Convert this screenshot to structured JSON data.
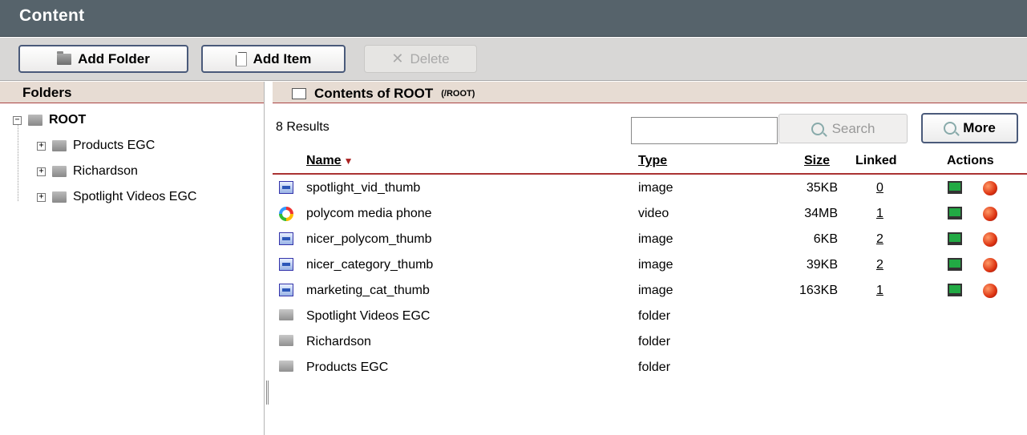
{
  "app": {
    "title": "Content"
  },
  "toolbar": {
    "add_folder_label": "Add Folder",
    "add_item_label": "Add Item",
    "delete_label": "Delete"
  },
  "folders_panel": {
    "title": "Folders",
    "root_label": "ROOT",
    "children": [
      "Products EGC",
      "Richardson",
      "Spotlight Videos EGC"
    ]
  },
  "contents_panel": {
    "title": "Contents of ROOT",
    "path": "(/ROOT)",
    "results_count": "8 Results",
    "search_value": "",
    "search_label": "Search",
    "more_label": "More",
    "columns": {
      "name": "Name",
      "type": "Type",
      "size": "Size",
      "linked": "Linked",
      "actions": "Actions"
    },
    "rows": [
      {
        "name": "spotlight_vid_thumb",
        "type": "image",
        "size": "35KB",
        "linked": "0",
        "icon": "image-icon"
      },
      {
        "name": "polycom media phone",
        "type": "video",
        "size": "34MB",
        "linked": "1",
        "icon": "video-icon"
      },
      {
        "name": "nicer_polycom_thumb",
        "type": "image",
        "size": "6KB",
        "linked": "2",
        "icon": "image-icon"
      },
      {
        "name": "nicer_category_thumb",
        "type": "image",
        "size": "39KB",
        "linked": "2",
        "icon": "image-icon"
      },
      {
        "name": "marketing_cat_thumb",
        "type": "image",
        "size": "163KB",
        "linked": "1",
        "icon": "image-icon"
      },
      {
        "name": "Spotlight Videos EGC",
        "type": "folder",
        "size": "",
        "linked": "",
        "icon": "folder-icon"
      },
      {
        "name": "Richardson",
        "type": "folder",
        "size": "",
        "linked": "",
        "icon": "folder-icon"
      },
      {
        "name": "Products EGC",
        "type": "folder",
        "size": "",
        "linked": "",
        "icon": "folder-icon"
      }
    ]
  },
  "colors": {
    "titlebar": "#56636b",
    "toolbar": "#d8d7d6",
    "panel_header": "#e7dcd3",
    "accent_border": "#a33"
  }
}
